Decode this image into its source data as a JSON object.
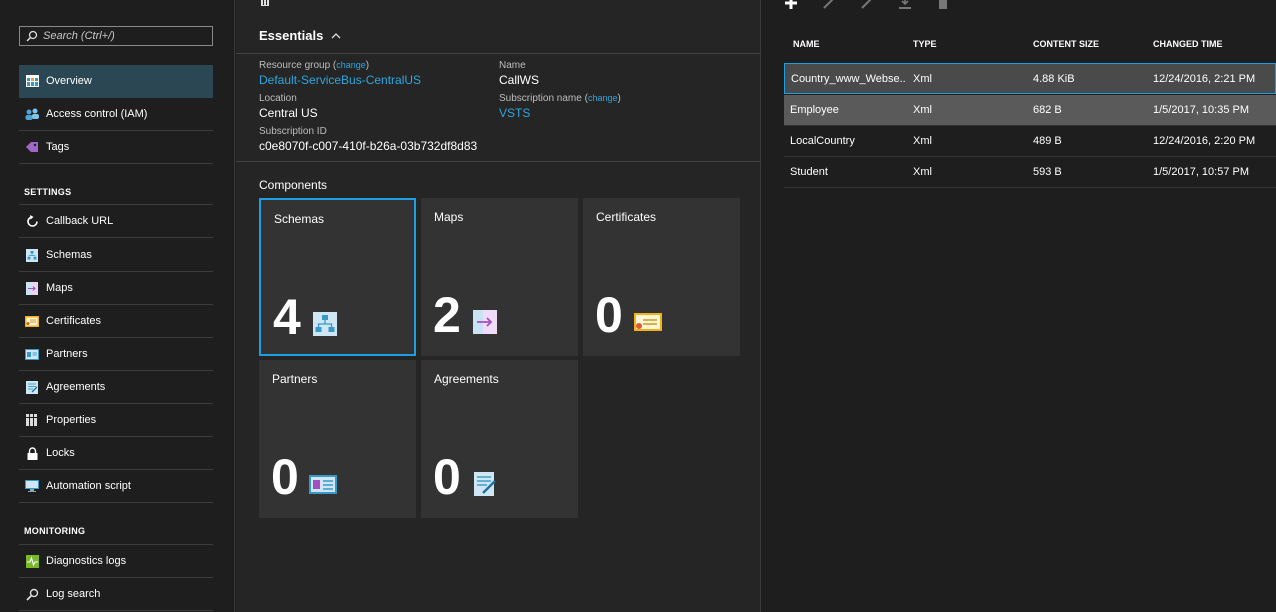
{
  "sidebar": {
    "search_placeholder": "Search (Ctrl+/)",
    "items": [
      {
        "label": "Overview"
      },
      {
        "label": "Access control (IAM)"
      },
      {
        "label": "Tags"
      }
    ],
    "settings_label": "SETTINGS",
    "settings": [
      {
        "label": "Callback URL"
      },
      {
        "label": "Schemas"
      },
      {
        "label": "Maps"
      },
      {
        "label": "Certificates"
      },
      {
        "label": "Partners"
      },
      {
        "label": "Agreements"
      },
      {
        "label": "Properties"
      },
      {
        "label": "Locks"
      },
      {
        "label": "Automation script"
      }
    ],
    "monitoring_label": "MONITORING",
    "monitoring": [
      {
        "label": "Diagnostics logs"
      },
      {
        "label": "Log search"
      }
    ]
  },
  "essentials": {
    "title": "Essentials",
    "change_label": "change",
    "resource_group_label": "Resource group",
    "resource_group": "Default-ServiceBus-CentralUS",
    "name_label": "Name",
    "name": "CallWS",
    "location_label": "Location",
    "location": "Central US",
    "subscription_name_label": "Subscription name",
    "subscription_name": "VSTS",
    "subscription_id_label": "Subscription ID",
    "subscription_id": "c0e8070f-c007-410f-b26a-03b732df8d83"
  },
  "components": {
    "title": "Components",
    "tiles": [
      {
        "title": "Schemas",
        "count": "4"
      },
      {
        "title": "Maps",
        "count": "2"
      },
      {
        "title": "Certificates",
        "count": "0"
      },
      {
        "title": "Partners",
        "count": "0"
      },
      {
        "title": "Agreements",
        "count": "0"
      }
    ]
  },
  "table": {
    "headers": {
      "name": "NAME",
      "type": "TYPE",
      "size": "CONTENT SIZE",
      "changed": "CHANGED TIME"
    },
    "rows": [
      {
        "name": "Country_www_Webse...",
        "type": "Xml",
        "size": "4.88 KiB",
        "changed": "12/24/2016, 2:21 PM"
      },
      {
        "name": "Employee",
        "type": "Xml",
        "size": "682 B",
        "changed": "1/5/2017, 10:35 PM"
      },
      {
        "name": "LocalCountry",
        "type": "Xml",
        "size": "489 B",
        "changed": "12/24/2016, 2:20 PM"
      },
      {
        "name": "Student",
        "type": "Xml",
        "size": "593 B",
        "changed": "1/5/2017, 10:57 PM"
      }
    ]
  },
  "colors": {
    "accent": "#1ba1e2",
    "link": "#2ea6df",
    "active_nav": "#2a4753"
  }
}
